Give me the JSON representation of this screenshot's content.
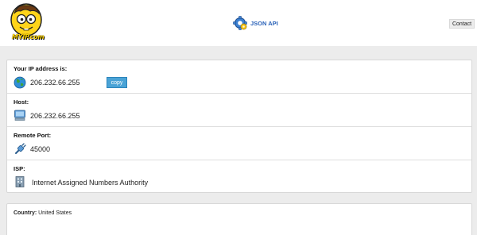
{
  "header": {
    "logo_text": "MYIP.com",
    "json_api_label": "JSON API",
    "contact_label": "Contact"
  },
  "ip_info": {
    "ip_label": "Your IP address is:",
    "ip_value": "206.232.66.255",
    "copy_label": "copy",
    "host_label": "Host:",
    "host_value": "206.232.66.255",
    "port_label": "Remote Port:",
    "port_value": "45000",
    "isp_label": "ISP:",
    "isp_value": "Internet Assigned Numbers Authority"
  },
  "country": {
    "label": "Country:",
    "value": "United States"
  },
  "colors": {
    "accent_blue": "#2a62b8",
    "copy_button": "#4aa3d6",
    "background": "#ececec"
  },
  "icons": [
    "mascot-logo",
    "gear-icon",
    "globe-icon",
    "computer-icon",
    "plug-icon",
    "building-icon"
  ]
}
